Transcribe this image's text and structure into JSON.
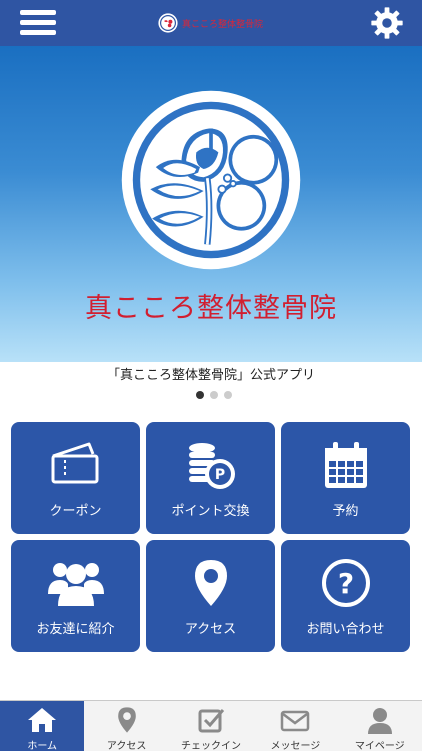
{
  "header": {
    "title": "真こころ整体整骨院",
    "menu_icon": "hamburger-menu-icon",
    "settings_icon": "gear-icon",
    "accent_color": "#2f55a3"
  },
  "hero": {
    "clinic_name": "真こころ整体整骨院",
    "name_color": "#d11f30",
    "logo_icon": "camellia-crest-icon"
  },
  "caption": "「真こころ整体整骨院」公式アプリ",
  "carousel": {
    "page": 1,
    "total": 3
  },
  "tiles": [
    {
      "label": "クーポン",
      "icon": "ticket-icon"
    },
    {
      "label": "ポイント交換",
      "icon": "coins-icon"
    },
    {
      "label": "予約",
      "icon": "calendar-icon"
    },
    {
      "label": "お友達に紹介",
      "icon": "users-icon"
    },
    {
      "label": "アクセス",
      "icon": "map-pin-icon"
    },
    {
      "label": "お問い合わせ",
      "icon": "question-icon"
    }
  ],
  "tabbar": [
    {
      "label": "ホーム",
      "icon": "home-icon",
      "active": true
    },
    {
      "label": "アクセス",
      "icon": "map-pin-icon",
      "active": false
    },
    {
      "label": "チェックイン",
      "icon": "checkin-icon",
      "active": false
    },
    {
      "label": "メッセージ",
      "icon": "envelope-icon",
      "active": false
    },
    {
      "label": "マイページ",
      "icon": "person-icon",
      "active": false
    }
  ]
}
